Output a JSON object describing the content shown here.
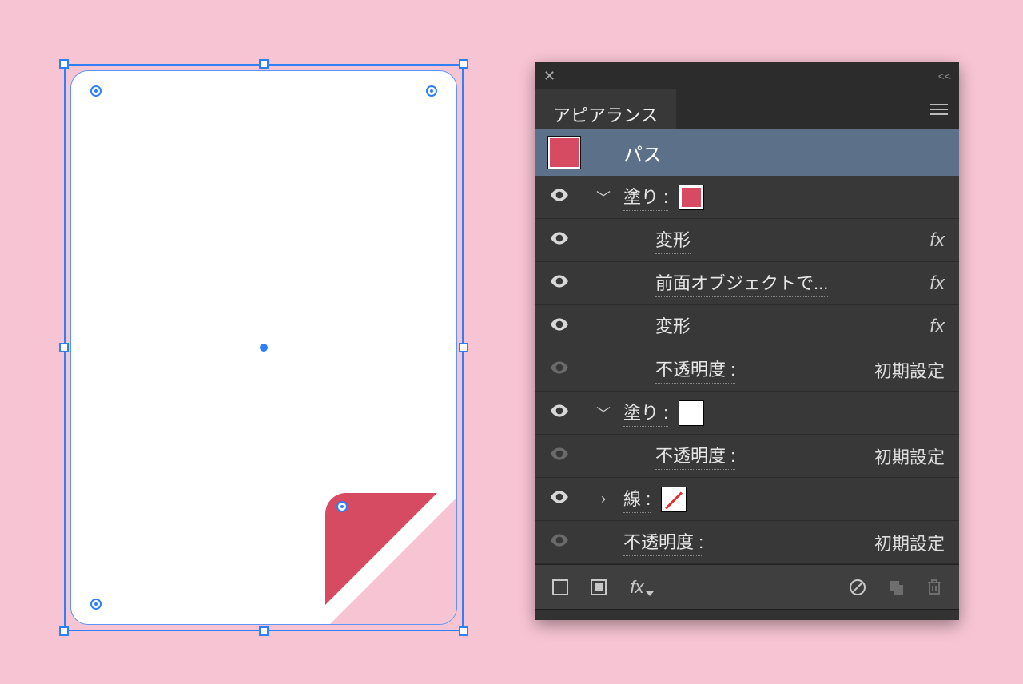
{
  "panel": {
    "tab_title": "アピアランス",
    "header": {
      "swatch": "#d64b61",
      "label": "パス"
    },
    "fill1": {
      "label": "塗り :",
      "swatch": "#d64b61",
      "effects": [
        {
          "label": "変形",
          "fx": "fx"
        },
        {
          "label": "前面オブジェクトで...",
          "fx": "fx"
        },
        {
          "label": "変形",
          "fx": "fx"
        }
      ],
      "opacity": {
        "label": "不透明度 :",
        "value": "初期設定"
      }
    },
    "fill2": {
      "label": "塗り :",
      "swatch": "#ffffff",
      "opacity": {
        "label": "不透明度 :",
        "value": "初期設定"
      }
    },
    "stroke": {
      "label": "線 :",
      "swatch": "none"
    },
    "opacity": {
      "label": "不透明度 :",
      "value": "初期設定"
    },
    "footer": {
      "fx": "fx"
    }
  }
}
